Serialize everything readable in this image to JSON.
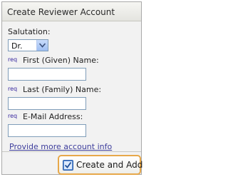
{
  "panel": {
    "title": "Create Reviewer Account"
  },
  "form": {
    "salutation": {
      "label": "Salutation:",
      "selected": "Dr."
    },
    "required_marker": "req",
    "first_name": {
      "label": "First (Given) Name:",
      "value": ""
    },
    "last_name": {
      "label": "Last (Family) Name:",
      "value": ""
    },
    "email": {
      "label": "E-Mail Address:",
      "value": ""
    },
    "more_info_link": "Provide more account info"
  },
  "actions": {
    "create_and_add_label": "Create and Add",
    "create_and_add_icon": "checkmark-icon"
  },
  "colors": {
    "required_marker": "#3a2aa0",
    "link": "#3d3d9c",
    "button_border": "#e7a84a",
    "input_border": "#7f9db9"
  }
}
